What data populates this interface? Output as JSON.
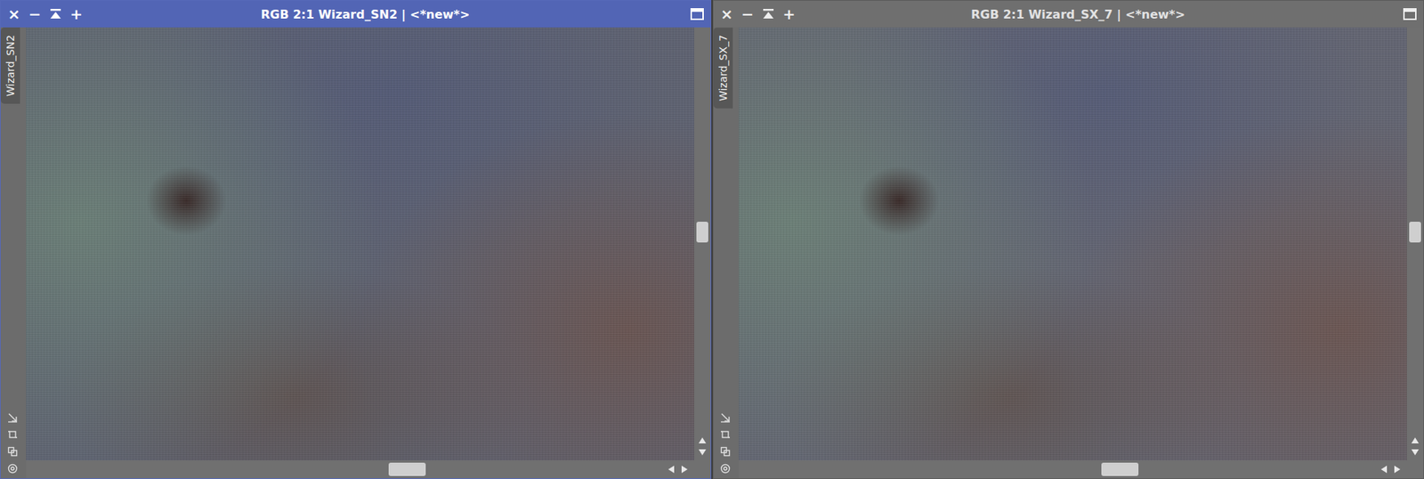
{
  "windows": [
    {
      "title": "RGB 2:1 Wizard_SN2 | <*new*>",
      "tab": "Wizard_SN2",
      "selected": true,
      "buttons": [
        "×",
        "−",
        "+"
      ],
      "scroll": {
        "horizontal": 0.6,
        "vertical": 0.59
      }
    },
    {
      "title": "RGB 2:1 Wizard_SX_7 | <*new*>",
      "tab": "Wizard_SX_7",
      "selected": false,
      "buttons": [
        "×",
        "−",
        "+"
      ],
      "scroll": {
        "horizontal": 0.6,
        "vertical": 0.59
      }
    }
  ]
}
